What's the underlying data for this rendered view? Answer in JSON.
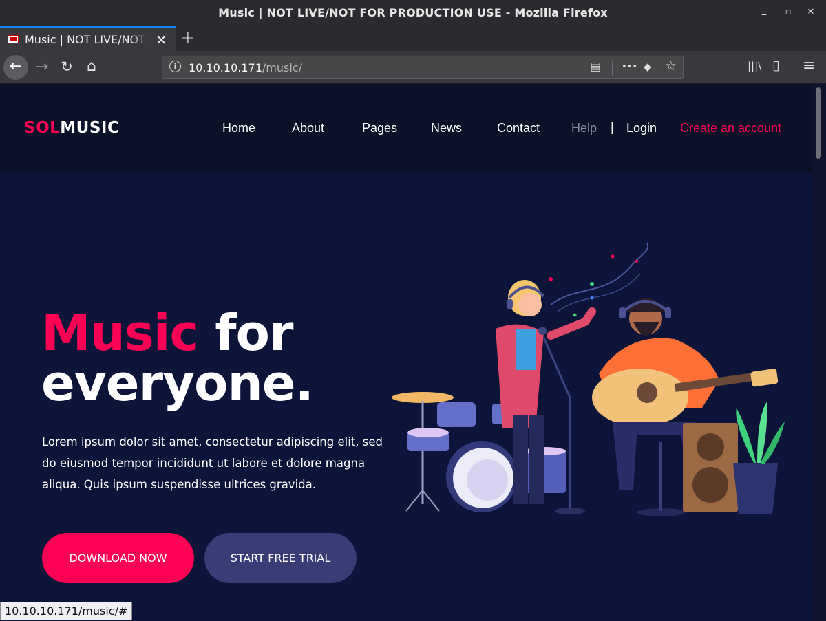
{
  "window": {
    "title": "Music | NOT LIVE/NOT FOR PRODUCTION USE - Mozilla Firefox",
    "controls": {
      "minimize": "_",
      "maximize": "▫",
      "close": "✕"
    }
  },
  "tab": {
    "label": "Music | NOT LIVE/NOT FOR PRODUCTION USE",
    "close": "✕",
    "new_tab": "+"
  },
  "toolbar": {
    "back": "←",
    "forward": "→",
    "reload": "↻",
    "home": "⌂",
    "url_host": "10.10.10.171",
    "url_path": "/music/",
    "info": "i",
    "reader": "▤",
    "more": "•••",
    "pocket": "◆",
    "bookmark": "☆",
    "library": "|||\\",
    "sidebar": "▯",
    "menu": "≡"
  },
  "site": {
    "logo_a": "SOL",
    "logo_b": "MUSIC",
    "nav": [
      "Home",
      "About",
      "Pages",
      "News",
      "Contact"
    ],
    "help": "Help",
    "separator": "|",
    "login": "Login",
    "create_account": "Create an account",
    "colors": {
      "accent": "#fc0254",
      "header_bg": "#0b1227",
      "hero_bg": "#0d1439",
      "secondary_btn": "#3a3c75"
    }
  },
  "hero": {
    "title_pink": "Music",
    "title_rest_1": " for",
    "title_line2": "everyone.",
    "text": "Lorem ipsum dolor sit amet, consectetur adipiscing elit, sed do eiusmod tempor incididunt ut labore et dolore magna aliqua. Quis ipsum suspendisse ultrices gravida.",
    "download_button": "DOWNLOAD NOW",
    "trial_button": "START FREE TRIAL"
  },
  "status": {
    "link": "10.10.10.171/music/#"
  }
}
